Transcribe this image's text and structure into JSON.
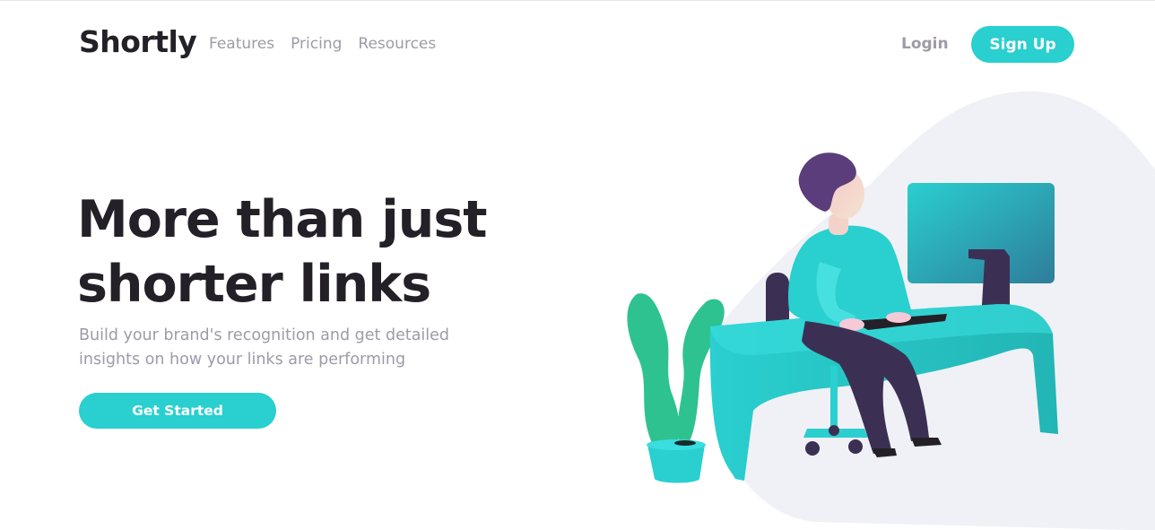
{
  "header": {
    "logo": "Shortly",
    "nav": [
      "Features",
      "Pricing",
      "Resources"
    ],
    "login_label": "Login",
    "signup_label": "Sign Up"
  },
  "hero": {
    "title_line1": "More than just",
    "title_line2": "shorter links",
    "subtitle_line1": "Build your brand's recognition and get detailed",
    "subtitle_line2": "insights on how your links are performing",
    "cta_label": "Get Started"
  },
  "colors": {
    "brand_cyan": "#2acfcf",
    "dark_violet": "#3b3054",
    "very_dark_violet": "#232127",
    "grayish_violet": "#9e9aa7",
    "blob": "#f0f1f6"
  },
  "illustration": {
    "icon": "person-working-at-desk-illustration"
  }
}
